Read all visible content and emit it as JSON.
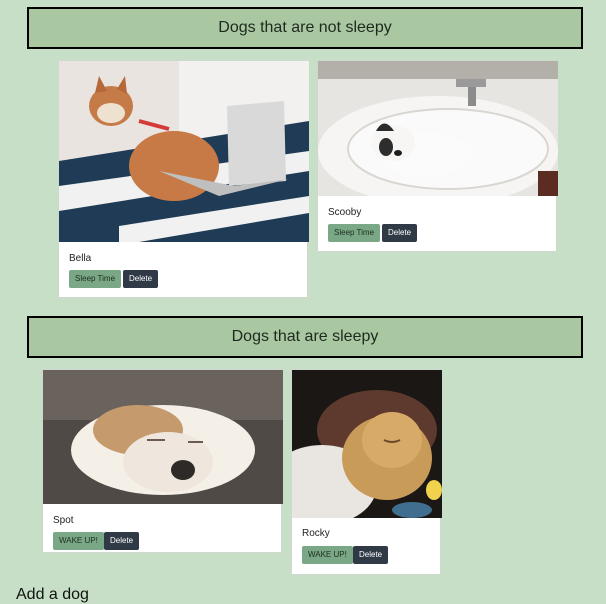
{
  "colors": {
    "background": "#c6dfc6",
    "header": "#a9c7a0",
    "button_green": "#7aa786",
    "button_dark": "#2f3a46"
  },
  "sections": [
    {
      "title": "Dogs that are not sleepy",
      "dogs": [
        {
          "name": "Bella",
          "primary_action": "Sleep Time",
          "delete_label": "Delete",
          "photo": "shiba-with-laptop-photo"
        },
        {
          "name": "Scooby",
          "primary_action": "Sleep Time",
          "delete_label": "Delete",
          "photo": "french-bulldog-in-sink-photo"
        }
      ]
    },
    {
      "title": "Dogs that are sleepy",
      "dogs": [
        {
          "name": "Spot",
          "primary_action": "WAKE UP!",
          "delete_label": "Delete",
          "photo": "sleeping-white-dog-photo"
        },
        {
          "name": "Rocky",
          "primary_action": "WAKE UP!",
          "delete_label": "Delete",
          "photo": "sleeping-puppy-photo"
        }
      ]
    }
  ],
  "footer": {
    "partial_heading": "Add a dog"
  }
}
